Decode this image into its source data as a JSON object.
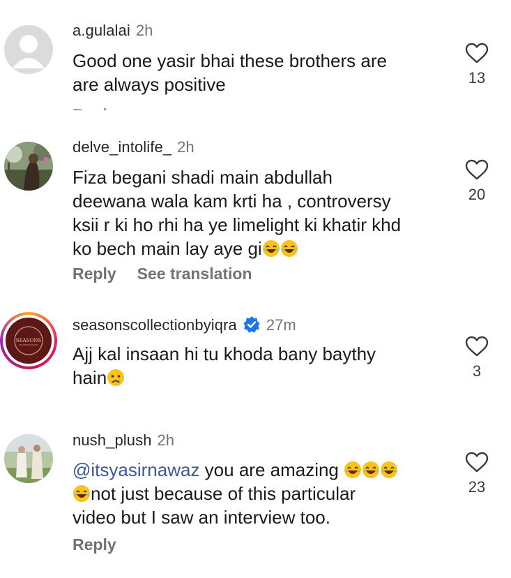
{
  "comments": [
    {
      "username": "a.gulalai",
      "time": "2h",
      "text_lines": [
        "Good one yasir bhai these brothers are",
        "are always positive"
      ],
      "likes": "13",
      "cut_action": "Reply",
      "avatar": "default-avatar"
    },
    {
      "username": "delve_intolife_",
      "time": "2h",
      "text_lines": [
        "Fiza begani shadi main abdullah",
        "deewana wala kam krti ha , controversy",
        "ksii r ki ho rhi ha ye limelight ki khatir khd",
        "ko bech main lay aye gi"
      ],
      "likes": "20",
      "actions": [
        "Reply",
        "See translation"
      ],
      "avatar": "photo-avatar"
    },
    {
      "username": "seasonscollectionbyiqra",
      "time": "27m",
      "verified": true,
      "text_lines": [
        "Ajj kal insaan hi tu khoda bany baythy",
        "hain"
      ],
      "likes": "3",
      "avatar": "brand-logo-avatar",
      "avatar_brand_text": "SEASONS"
    },
    {
      "username": "nush_plush",
      "time": "2h",
      "mention": "@itsyasirnawaz",
      "text_lines": [
        " you are amazing ",
        "not just because of this particular",
        "video but I saw an interview too."
      ],
      "likes": "23",
      "actions": [
        "Reply"
      ],
      "avatar": "photo-avatar"
    }
  ],
  "colors": {
    "text": "#1a1a1a",
    "muted": "#737373",
    "mention": "#3b5998",
    "verified": "#1877f2",
    "story_ring": [
      "#f9a825",
      "#e91e63",
      "#9c27b0"
    ]
  },
  "icons": [
    "heart-icon",
    "verified-badge-icon",
    "laughing-emoji",
    "crying-emoji"
  ]
}
